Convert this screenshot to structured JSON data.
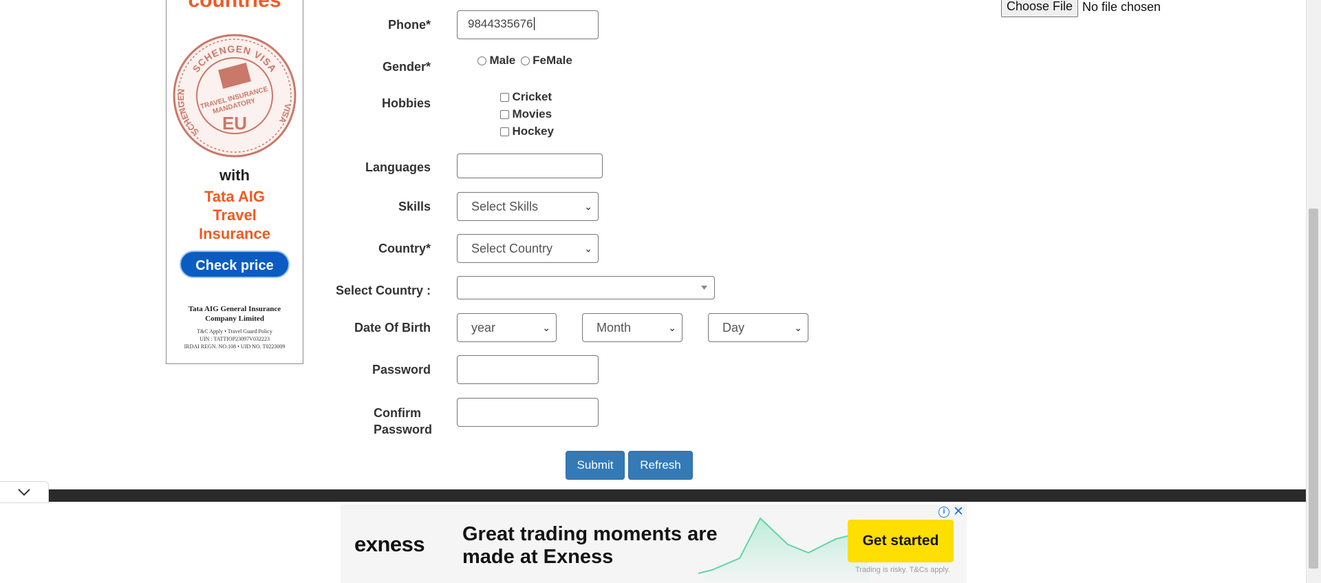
{
  "left_ad": {
    "countries": "countries",
    "seal_top": "SCHENGEN VISA",
    "seal_side": "SCHENGEN VISA",
    "seal_middle": "TRAVEL INSURANCE MANDATORY",
    "seal_bottom": "EU",
    "with": "with",
    "brand": "Tata AIG Travel Insurance",
    "cta": "Check price",
    "company": "Tata AIG General Insurance Company Limited",
    "fine_line1": "T&C Apply  •  Travel Guard Policy",
    "fine_line2": "UIN : TATTIOP23097V032223",
    "fine_line3": "IRDAI REGN. NO.108  •  UID NO. T0223009",
    "brand_color": "#f15a22",
    "cta_color": "#0a5cc2"
  },
  "file_upload": {
    "button_label": "Choose File",
    "status": "No file chosen"
  },
  "form": {
    "phone": {
      "label": "Phone*",
      "value": "9844335676"
    },
    "gender": {
      "label": "Gender*",
      "options": [
        "Male",
        "FeMale"
      ]
    },
    "hobbies": {
      "label": "Hobbies",
      "options": [
        "Cricket",
        "Movies",
        "Hockey"
      ]
    },
    "languages": {
      "label": "Languages",
      "value": ""
    },
    "skills": {
      "label": "Skills",
      "selected": "Select Skills"
    },
    "country": {
      "label": "Country*",
      "selected": "Select Country"
    },
    "select_country": {
      "label": "Select Country :",
      "selected": ""
    },
    "dob": {
      "label": "Date Of Birth",
      "year": "year",
      "month": "Month",
      "day": "Day"
    },
    "password": {
      "label": "Password",
      "value": ""
    },
    "confirm_password": {
      "label_line1": "Confirm",
      "label_line2": "Password",
      "value": ""
    },
    "submit_label": "Submit",
    "refresh_label": "Refresh",
    "button_color": "#337ab7"
  },
  "bottom_banner": {
    "logo": "exness",
    "headline": "Great trading moments are made at Exness",
    "cta": "Get started",
    "note": "Trading is risky. T&Cs apply.",
    "cta_color": "#ffde02"
  },
  "icons": {
    "collapse": "chevron-down-icon",
    "ad_info": "info-icon",
    "ad_close": "close-icon"
  }
}
